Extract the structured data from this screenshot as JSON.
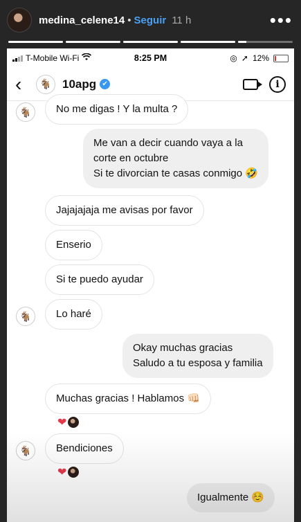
{
  "story": {
    "username": "medina_celene14",
    "dot": "•",
    "follow_label": "Seguir",
    "time": "11 h",
    "more_icon": "more-horizontal-icon",
    "progress": [
      1.0,
      1.0,
      1.0,
      1.0,
      0.15
    ]
  },
  "statusbar": {
    "carrier": "T-Mobile Wi-Fi",
    "time": "8:25 PM",
    "battery": "12%",
    "battery_level": 0.12
  },
  "chat": {
    "back_glyph": "‹",
    "name": "10apg",
    "verified_glyph": "✔"
  },
  "messages": [
    {
      "dir": "in",
      "text": "No me digas ! Y la multa ?"
    },
    {
      "dir": "out",
      "lines": [
        "Me van a decir cuando vaya a la",
        "corte en octubre",
        "Si te divorcian te casas conmigo 🤣"
      ]
    },
    {
      "dir": "in",
      "text": "Jajajajaja me avisas por favor"
    },
    {
      "dir": "in",
      "text": "Enserio"
    },
    {
      "dir": "in",
      "text": "Si te puedo ayudar"
    },
    {
      "dir": "in",
      "text": "Lo haré"
    },
    {
      "dir": "out",
      "lines": [
        "Okay muchas gracias",
        "Saludo a tu esposa y familia"
      ]
    },
    {
      "dir": "in",
      "text": "Muchas gracias ! Hablamos 👊🏻"
    },
    {
      "dir": "in",
      "text": "Bendiciones"
    },
    {
      "dir": "out",
      "text": "Igualmente ☺️"
    }
  ],
  "reaction_heart": "❤",
  "avatar_glyph": "🐐",
  "colors": {
    "accent": "#3897f0",
    "follow": "#4aa0f5",
    "heart": "#e23b4d"
  }
}
